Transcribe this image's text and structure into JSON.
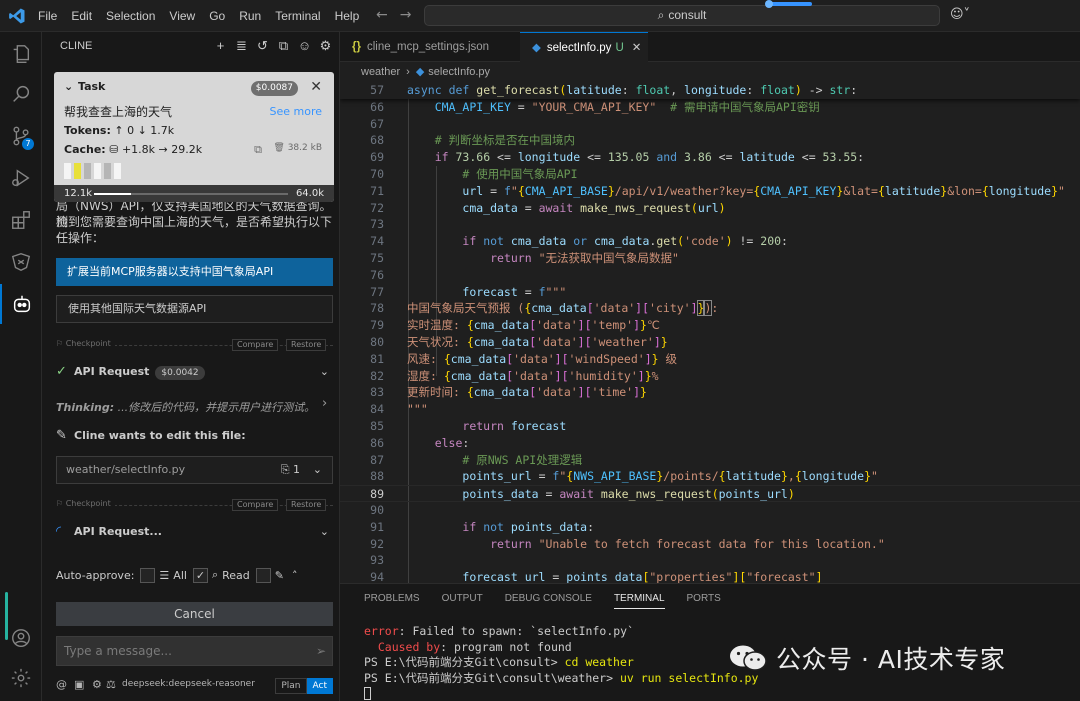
{
  "menu": [
    "File",
    "Edit",
    "Selection",
    "View",
    "Go",
    "Run",
    "Terminal",
    "Help"
  ],
  "search": {
    "text": "consult"
  },
  "activity": {
    "source_control_badge": "7"
  },
  "cline": {
    "header": "CLINE",
    "task": {
      "label": "Task",
      "cost": "$0.0087",
      "title": "帮我查查上海的天气",
      "see_more": "See more",
      "tokens_label": "Tokens:",
      "tokens_up": "0",
      "tokens_down": "1.7k",
      "cache_label": "Cache:",
      "cache_write": "+1.8k",
      "cache_read": "29.2k",
      "size": "38.2 kB",
      "context_used": "12.1k",
      "context_max": "64.0k",
      "context_fraction": 0.19
    },
    "chat": {
      "partial_text_1": "局（NWS）API，仅支持美国地区的天气数据查询。检",
      "partial_text_2": "测到您需要查询中国上海的天气，是否希望执行以下任",
      "partial_text_3": "一操作：",
      "option_1": "扩展当前MCP服务器以支持中国气象局API",
      "option_2": "使用其他国际天气数据源API",
      "checkpoint": "Checkpoint",
      "compare": "Compare",
      "restore": "Restore",
      "api_request_label": "API Request",
      "api_request_cost": "$0.0042",
      "thinking_label": "Thinking:",
      "thinking_text": "...修改后的代码，并提示用户进行测试。",
      "edit_title": "Cline wants to edit this file:",
      "edit_file": "weather/selectInfo.py",
      "edit_count": "1",
      "api_request_pending": "API Request..."
    },
    "auto_approve": {
      "label": "Auto-approve:",
      "all": "All",
      "read": "Read"
    },
    "cancel": "Cancel",
    "input_placeholder": "Type a message...",
    "model": "deepseek:deepseek-reasoner",
    "plan": "Plan",
    "act": "Act"
  },
  "tabs": [
    {
      "label": "cline_mcp_settings.json"
    },
    {
      "label": "selectInfo.py",
      "modified": "U"
    }
  ],
  "breadcrumb": {
    "folder": "weather",
    "file": "selectInfo.py"
  },
  "panel": {
    "tabs": [
      "PROBLEMS",
      "OUTPUT",
      "DEBUG CONSOLE",
      "TERMINAL",
      "PORTS"
    ],
    "terminal": {
      "error_label": "error",
      "error_text": ": Failed to spawn: `selectInfo.py`",
      "caused_label": "  Caused by",
      "caused_text": ": program not found",
      "prompt1": "PS E:\\代码前端分支Git\\consult> ",
      "cmd1": "cd weather",
      "prompt2": "PS E:\\代码前端分支Git\\consult\\weather> ",
      "cmd2": "uv run selectInfo.py"
    }
  },
  "watermark": "公众号 · AI技术专家",
  "colors": {
    "accent": "#0078d4",
    "button": "#0e639c",
    "error": "#f14c4c"
  }
}
